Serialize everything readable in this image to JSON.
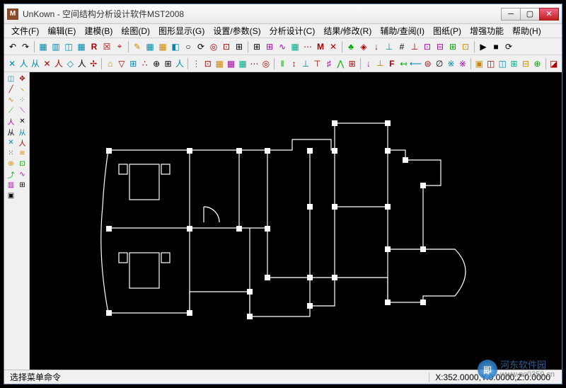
{
  "title": "UnKown - 空间结构分析设计软件MST2008",
  "app_icon_letter": "M",
  "menus": [
    "文件(F)",
    "编辑(E)",
    "建模(B)",
    "绘图(D)",
    "图形显示(G)",
    "设置/参数(S)",
    "分析设计(C)",
    "结果/修改(R)",
    "辅助/查阅(I)",
    "图纸(P)",
    "增强功能",
    "帮助(H)"
  ],
  "toolbar1": [
    {
      "glyph": "↶",
      "c": "#000"
    },
    {
      "glyph": "↷",
      "c": "#000"
    },
    {
      "sep": true
    },
    {
      "glyph": "▦",
      "c": "#08a"
    },
    {
      "glyph": "▥",
      "c": "#08a"
    },
    {
      "glyph": "◫",
      "c": "#08a"
    },
    {
      "glyph": "▦",
      "c": "#08a"
    },
    {
      "glyph": "R",
      "c": "#a00",
      "b": true
    },
    {
      "glyph": "☒",
      "c": "#a00"
    },
    {
      "glyph": "⌖",
      "c": "#a00"
    },
    {
      "sep": true
    },
    {
      "glyph": "✎",
      "c": "#c80"
    },
    {
      "glyph": "▦",
      "c": "#08a"
    },
    {
      "glyph": "▦",
      "c": "#c80"
    },
    {
      "glyph": "◧",
      "c": "#08a"
    },
    {
      "glyph": "○",
      "c": "#000"
    },
    {
      "glyph": "⟳",
      "c": "#000"
    },
    {
      "glyph": "◎",
      "c": "#a00"
    },
    {
      "glyph": "⊡",
      "c": "#a00"
    },
    {
      "glyph": "⊞",
      "c": "#000"
    },
    {
      "sep": true
    },
    {
      "glyph": "⊞",
      "c": "#000"
    },
    {
      "glyph": "⊞",
      "c": "#a0a"
    },
    {
      "glyph": "∿",
      "c": "#a0a"
    },
    {
      "glyph": "▦",
      "c": "#0a8"
    },
    {
      "glyph": "⋯",
      "c": "#a00"
    },
    {
      "glyph": "M",
      "c": "#a00",
      "b": true
    },
    {
      "glyph": "✕",
      "c": "#a00"
    },
    {
      "sep": true
    },
    {
      "glyph": "♣",
      "c": "#0a0"
    },
    {
      "glyph": "◈",
      "c": "#a00"
    },
    {
      "glyph": "↓",
      "c": "#a00"
    },
    {
      "glyph": "⊥",
      "c": "#08a"
    },
    {
      "glyph": "#",
      "c": "#000"
    },
    {
      "glyph": "⊥",
      "c": "#a00"
    },
    {
      "glyph": "⊡",
      "c": "#a0a"
    },
    {
      "glyph": "⊟",
      "c": "#a0a"
    },
    {
      "glyph": "⊞",
      "c": "#0a0"
    },
    {
      "glyph": "⊡",
      "c": "#c80"
    },
    {
      "sep": true
    },
    {
      "glyph": "▶",
      "c": "#000"
    },
    {
      "glyph": "■",
      "c": "#000"
    },
    {
      "glyph": "⟳",
      "c": "#000"
    }
  ],
  "toolbar2": [
    {
      "glyph": "✕",
      "c": "#08a"
    },
    {
      "glyph": "人",
      "c": "#08a"
    },
    {
      "glyph": "从",
      "c": "#08a"
    },
    {
      "glyph": "✕",
      "c": "#a00"
    },
    {
      "glyph": "人",
      "c": "#a00"
    },
    {
      "glyph": "◇",
      "c": "#08a"
    },
    {
      "glyph": "人",
      "c": "#000"
    },
    {
      "glyph": "✢",
      "c": "#a00"
    },
    {
      "sep": true
    },
    {
      "glyph": "⌂",
      "c": "#c80"
    },
    {
      "glyph": "▽",
      "c": "#a00"
    },
    {
      "glyph": "⊞",
      "c": "#08a"
    },
    {
      "glyph": "∴",
      "c": "#a00"
    },
    {
      "glyph": "⊕",
      "c": "#000"
    },
    {
      "glyph": "⊞",
      "c": "#000"
    },
    {
      "glyph": "人",
      "c": "#08a"
    },
    {
      "sep": true
    },
    {
      "glyph": "⋮",
      "c": "#0a0"
    },
    {
      "glyph": "⊡",
      "c": "#a00"
    },
    {
      "glyph": "▦",
      "c": "#c80"
    },
    {
      "glyph": "▦",
      "c": "#a0a"
    },
    {
      "glyph": "▦",
      "c": "#0a8"
    },
    {
      "glyph": "⋯",
      "c": "#a00"
    },
    {
      "glyph": "◎",
      "c": "#a00"
    },
    {
      "sep": true
    },
    {
      "glyph": "‖",
      "c": "#0a0"
    },
    {
      "glyph": "↕",
      "c": "#a00"
    },
    {
      "glyph": "⊥",
      "c": "#08a"
    },
    {
      "glyph": "⊤",
      "c": "#a00"
    },
    {
      "glyph": "♯",
      "c": "#a0a"
    },
    {
      "glyph": "⋀",
      "c": "#0a0"
    },
    {
      "glyph": "⊞",
      "c": "#a00"
    },
    {
      "sep": true
    },
    {
      "glyph": "↓",
      "c": "#a0a"
    },
    {
      "glyph": "⟂",
      "c": "#c80"
    },
    {
      "glyph": "F",
      "c": "#a00",
      "b": true
    },
    {
      "glyph": "↤",
      "c": "#0a0"
    },
    {
      "glyph": "⟵",
      "c": "#08a"
    },
    {
      "glyph": "⊜",
      "c": "#a00"
    },
    {
      "glyph": "∅",
      "c": "#000"
    },
    {
      "glyph": "※",
      "c": "#08a"
    },
    {
      "glyph": "※",
      "c": "#a0a"
    },
    {
      "sep": true
    },
    {
      "glyph": "▣",
      "c": "#c80"
    },
    {
      "glyph": "◫",
      "c": "#a00"
    },
    {
      "glyph": "◫",
      "c": "#08a"
    },
    {
      "glyph": "⊞",
      "c": "#0a8"
    },
    {
      "glyph": "⊟",
      "c": "#c80"
    },
    {
      "glyph": "⊕",
      "c": "#0a0"
    },
    {
      "sep": true
    },
    {
      "glyph": "◪",
      "c": "#a00"
    }
  ],
  "left_tools": [
    [
      "◫",
      "✥"
    ],
    [
      "╱",
      "丶"
    ],
    [
      "∿",
      "⁘"
    ],
    [
      "⟋",
      "⟍"
    ],
    [
      "人",
      "✕"
    ],
    [
      "从",
      "从"
    ],
    [
      "✕",
      "人"
    ],
    [
      "⁙",
      "≋"
    ],
    [
      "⊚",
      "⊡"
    ],
    [
      "⤴",
      "∿"
    ],
    [
      "▥",
      "⊞"
    ],
    [
      "▣",
      ""
    ]
  ],
  "status": {
    "message": "选择菜单命令",
    "coords": "X:352.0000,Y:0.0000,Z:0.0000"
  },
  "watermark": {
    "site": "河东软件园",
    "url": "www.pc0359.cn",
    "logo": "即"
  }
}
